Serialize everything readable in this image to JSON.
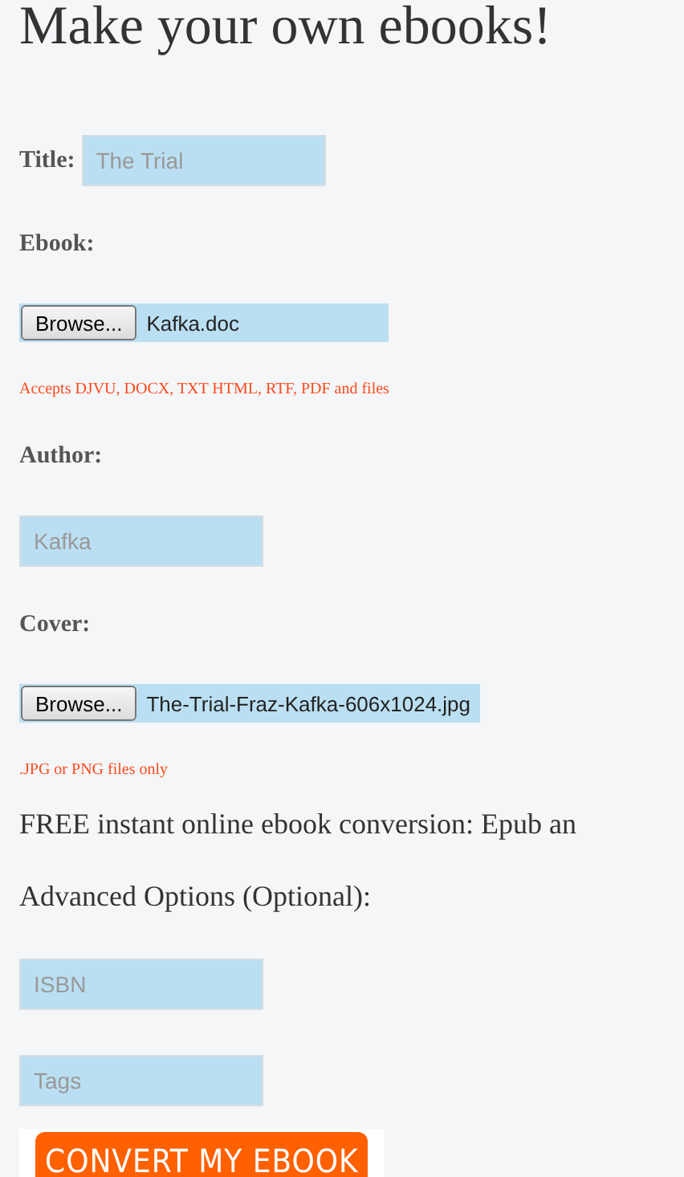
{
  "heading": "Make your own ebooks!",
  "fields": [
    {
      "kind": "inline_text",
      "label": "Title:",
      "placeholder": "The Trial"
    },
    {
      "kind": "file",
      "label": "Ebook:",
      "button": "Browse...",
      "filename": "Kafka.doc",
      "note": "Accepts DJVU, DOCX, TXT HTML, RTF, PDF and files"
    },
    {
      "kind": "text",
      "label": "Author:",
      "placeholder": "Kafka"
    },
    {
      "kind": "file",
      "label": "Cover:",
      "button": "Browse...",
      "filename": "The-Trial-Fraz-Kafka-606x1024.jpg",
      "note": ".JPG or PNG files only"
    }
  ],
  "tagline": "FREE instant online ebook conversion: Epub an",
  "advanced_heading": "Advanced Options (Optional):",
  "advanced_fields": [
    {
      "placeholder": "ISBN"
    },
    {
      "placeholder": "Tags"
    }
  ],
  "submit": "CONVERT MY EBOOK"
}
